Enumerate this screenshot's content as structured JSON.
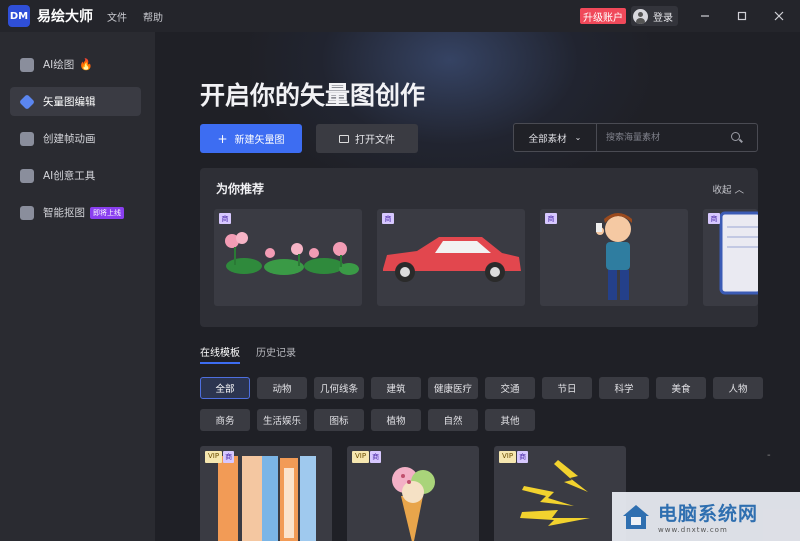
{
  "titlebar": {
    "logo": "DM",
    "app_name": "易绘大师",
    "menus": [
      "文件",
      "帮助"
    ],
    "upgrade": "升级账户",
    "login": "登录",
    "window_controls": [
      "minimize-icon",
      "maximize-icon",
      "close-icon"
    ]
  },
  "sidebar": {
    "items": [
      {
        "label": "AI绘图",
        "icon": "ai-draw-icon",
        "hot": true
      },
      {
        "label": "矢量图编辑",
        "icon": "vector-edit-icon",
        "active": true
      },
      {
        "label": "创建帧动画",
        "icon": "frame-animation-icon"
      },
      {
        "label": "AI创意工具",
        "icon": "ai-tools-icon"
      },
      {
        "label": "智能抠图",
        "icon": "cutout-icon",
        "badge": "即将上线"
      }
    ]
  },
  "main": {
    "hero_title": "开启你的矢量图创作",
    "new_button": "新建矢量图",
    "open_button": "打开文件",
    "search": {
      "category": "全部素材",
      "placeholder": "搜索海量素材"
    },
    "recommend": {
      "title": "为你推荐",
      "collapse": "收起",
      "badge": "商",
      "cards": [
        "lotus",
        "red-car",
        "cartoon-boy",
        "clipboard"
      ]
    },
    "tabs": [
      "在线模板",
      "历史记录"
    ],
    "chips_row1": [
      "全部",
      "动物",
      "几何线条",
      "建筑",
      "健康医疗",
      "交通",
      "节日",
      "科学",
      "美食",
      "人物"
    ],
    "chips_row2": [
      "商务",
      "生活娱乐",
      "图标",
      "植物",
      "自然",
      "其他"
    ],
    "templates": [
      {
        "vip": "VIP",
        "shang": "商",
        "art": "color-strips"
      },
      {
        "vip": "VIP",
        "shang": "商",
        "art": "ice-cream"
      },
      {
        "vip": "VIP",
        "shang": "商",
        "art": "lightning"
      }
    ],
    "side_mark": "-"
  },
  "watermark": {
    "title": "电脑系统网",
    "url": "www.dnxtw.com"
  },
  "colors": {
    "accent": "#3d6df2",
    "upgrade": "#f0495a",
    "background": "#1f2026",
    "sidebar": "#2a2b31"
  }
}
